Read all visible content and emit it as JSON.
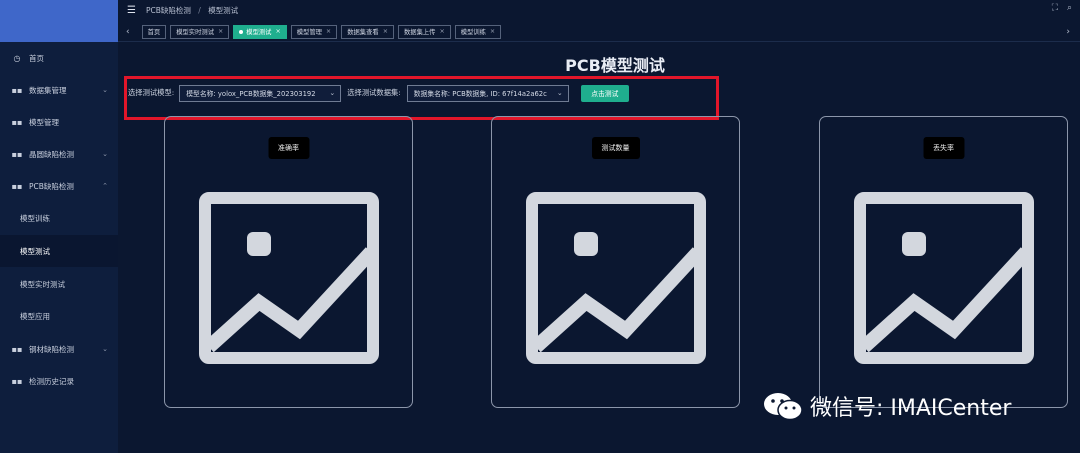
{
  "topbar": {
    "breadcrumb": [
      "PCB缺陷检测",
      "模型测试"
    ]
  },
  "sidebar": {
    "items": [
      {
        "label": "首页",
        "icon": "clock-icon"
      },
      {
        "label": "数据集管理",
        "icon": "grid-icon",
        "chevron": "⌄"
      },
      {
        "label": "模型管理",
        "icon": "grid-icon"
      },
      {
        "label": "晶圆缺陷检测",
        "icon": "grid-icon",
        "chevron": "⌄"
      },
      {
        "label": "PCB缺陷检测",
        "icon": "grid-icon",
        "chevron": "⌃"
      },
      {
        "label": "模型训练",
        "sub": true
      },
      {
        "label": "模型测试",
        "sub": true,
        "active": true
      },
      {
        "label": "模型实时测试",
        "sub": true
      },
      {
        "label": "模型应用",
        "sub": true
      },
      {
        "label": "钢材缺陷检测",
        "icon": "grid-icon",
        "chevron": "⌄"
      },
      {
        "label": "检测历史记录",
        "icon": "grid-icon"
      }
    ]
  },
  "tabs": [
    {
      "label": "首页",
      "closable": false
    },
    {
      "label": "模型实时测试",
      "closable": true
    },
    {
      "label": "模型测试",
      "closable": true,
      "active": true
    },
    {
      "label": "模型管理",
      "closable": true
    },
    {
      "label": "数据集查看",
      "closable": true
    },
    {
      "label": "数据集上传",
      "closable": true
    },
    {
      "label": "模型训练",
      "closable": true
    }
  ],
  "main": {
    "title": "PCB模型测试",
    "model_label": "选择测试模型:",
    "model_value": "模型名称: yolox_PCB数据集_202303192",
    "dataset_label": "选择测试数据集:",
    "dataset_value": "数据集名称: PCB数据集, ID: 67f14a2a62c",
    "test_button": "点击测试"
  },
  "cards": [
    {
      "label": "准确率"
    },
    {
      "label": "测试数量"
    },
    {
      "label": "丢失率"
    }
  ],
  "watermark": {
    "text": "微信号: IMAICenter"
  },
  "colors": {
    "accent": "#1fae8e",
    "highlight": "#e2162a",
    "background": "#0b1730",
    "sidebar": "#0e1e3d"
  }
}
